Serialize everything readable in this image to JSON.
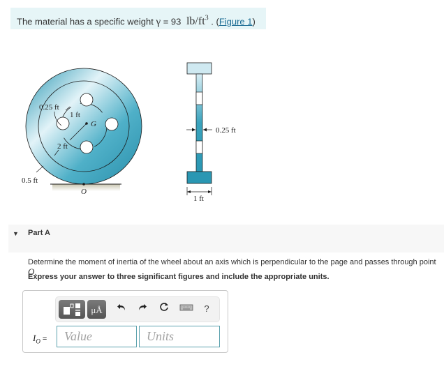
{
  "intro": {
    "text_before": "The material has a specific weight ",
    "gamma_symbol": "γ",
    "equals": " = 93 ",
    "unit": "lb/ft",
    "unit_exp": "3",
    "separator": " . (",
    "figure_link": "Figure 1",
    "closing": ")"
  },
  "figure": {
    "labels": {
      "hole_radius": "0.25 ft",
      "hole_circle_radius": "1 ft",
      "center": "G",
      "inner_radius": "2 ft",
      "rim_thickness": "0.5 ft",
      "contact_point": "O",
      "web_thickness": "0.25 ft",
      "rim_width": "1 ft"
    },
    "colors": {
      "wheel_dark": "#2a97b3",
      "wheel_light": "#e2f3f8",
      "outline": "#1b1b1b"
    }
  },
  "part": {
    "title": "Part A",
    "caret": "▼",
    "question": "Determine the moment of inertia of the wheel about an axis which is perpendicular to the page and passes through point ",
    "question_point": "O",
    "question_end": ".",
    "instruction": "Express your answer to three significant figures and include the appropriate units."
  },
  "answer": {
    "label_var": "I",
    "label_sub": "O",
    "label_eq": " =",
    "value_placeholder": "Value",
    "units_placeholder": "Units",
    "toolbar": {
      "templates_icon": "templates-icon",
      "units_button": "μÅ",
      "undo": "undo-icon",
      "redo": "redo-icon",
      "reset": "reset-icon",
      "keyboard": "keyboard-icon",
      "help": "?"
    }
  }
}
